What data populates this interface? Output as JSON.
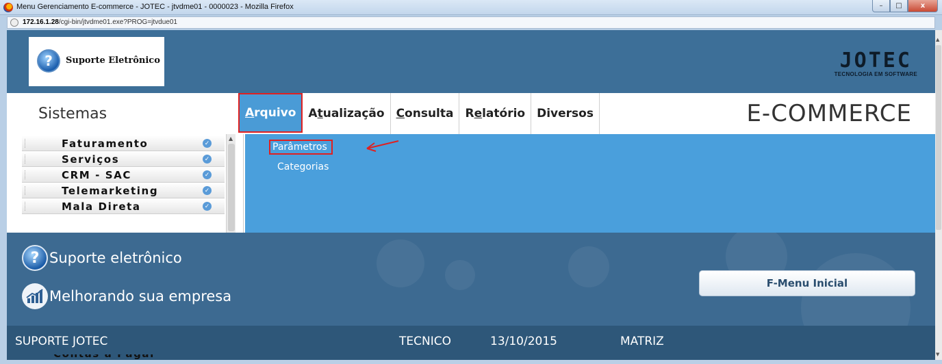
{
  "window": {
    "title": "Menu Gerenciamento E-commerce - JOTEC - jtvdme01 - 0000023 - Mozilla Firefox",
    "url_host": "172.16.1.28",
    "url_path": "/cgi-bin/jtvdme01.exe?PROG=jtvdue01",
    "controls": {
      "minimize": "–",
      "maximize": "□",
      "close": "x"
    }
  },
  "header": {
    "logo_text": "Suporte Eletrônico",
    "logo_icon": "question-icon",
    "brand_big": "JOTEC",
    "brand_small": "TECNOLOGIA EM SOFTWARE"
  },
  "nav": {
    "sistemas_label": "Sistemas",
    "menu": [
      {
        "pre": "",
        "ul": "A",
        "post": "rquivo",
        "active": true
      },
      {
        "pre": "A",
        "ul": "t",
        "post": "ualização",
        "active": false
      },
      {
        "pre": "",
        "ul": "C",
        "post": "onsulta",
        "active": false
      },
      {
        "pre": "R",
        "ul": "e",
        "post": "latório",
        "active": false
      },
      {
        "pre": "Diversos",
        "ul": "",
        "post": "",
        "active": false
      }
    ],
    "module_title": "E-COMMERCE"
  },
  "sidebar": {
    "items": [
      {
        "label": "Faturamento"
      },
      {
        "label": "Serviços"
      },
      {
        "label": "CRM - SAC"
      },
      {
        "label": "Telemarketing"
      },
      {
        "label": "Mala Direta"
      }
    ],
    "hidden_item": "Contas a Pagar"
  },
  "submenu": {
    "items": [
      {
        "label": "Parâmetros",
        "selected": true
      },
      {
        "label": "Categorias",
        "selected": false
      }
    ],
    "accent_color": "#e02020"
  },
  "footer": {
    "line1": "Suporte eletrônico",
    "line2": "Melhorando sua empresa",
    "fmenu_button": "F-Menu Inicial"
  },
  "status": {
    "company": "SUPORTE JOTEC",
    "user": "TECNICO",
    "date": "13/10/2015",
    "branch": "MATRIZ"
  },
  "colors": {
    "header_bg": "#3d6f98",
    "panel_bg": "#4a9fdc",
    "status_bg": "#2e5779"
  }
}
